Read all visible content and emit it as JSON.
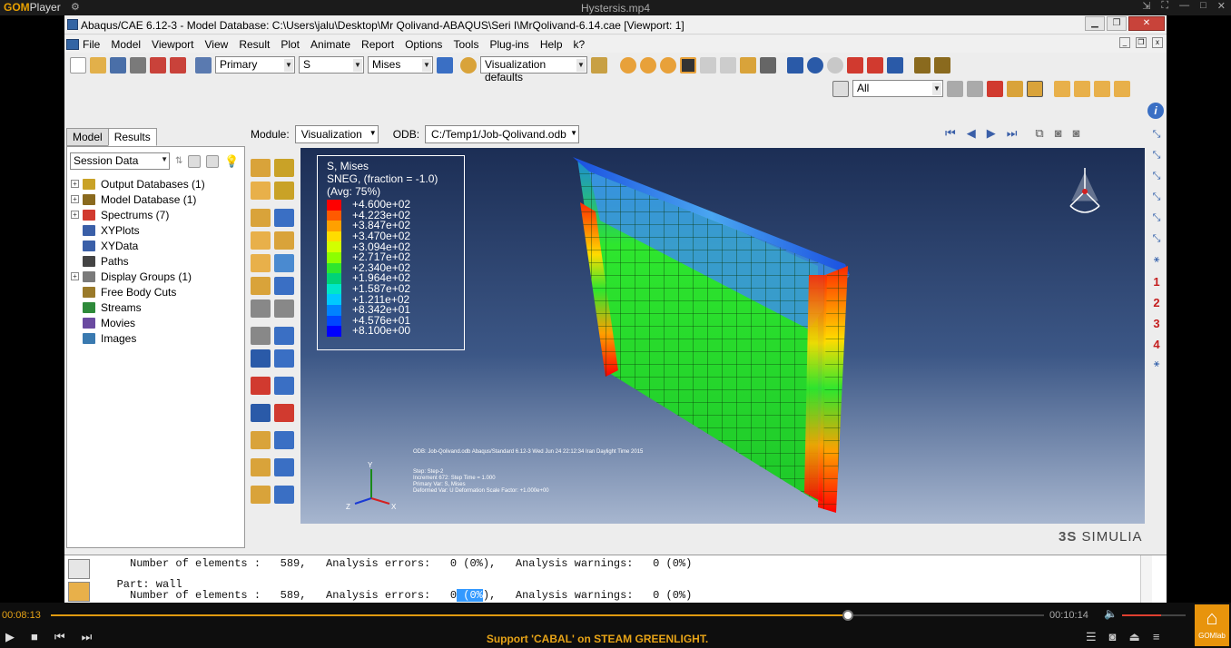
{
  "player": {
    "logo_main": "GOM",
    "logo_sub": "Player",
    "filename": "Hystersis.mp4",
    "time_current": "00:08:13",
    "time_total": "00:10:14",
    "progress": 0.803,
    "volume": 0.62,
    "banner": "Support 'CABAL' on STEAM GREENLIGHT.",
    "brand_label": "GOMlab"
  },
  "app": {
    "title": "Abaqus/CAE 6.12-3 - Model Database: C:\\Users\\jalu\\Desktop\\Mr Qolivand-ABAQUS\\Seri I\\MrQolivand-6.14.cae [Viewport: 1]",
    "menu": [
      "File",
      "Model",
      "Viewport",
      "View",
      "Result",
      "Plot",
      "Animate",
      "Report",
      "Options",
      "Tools",
      "Plug-ins",
      "Help",
      "k?"
    ],
    "toolbar": {
      "field_primary": "Primary",
      "field_var": "S",
      "field_invariant": "Mises",
      "viz_defaults": "Visualization defaults",
      "selection_filter": "All"
    },
    "tabs": [
      "Model",
      "Results"
    ],
    "session_select": "Session Data",
    "tree": [
      {
        "label": "Output Databases (1)",
        "expand": true,
        "color": "#c9a227"
      },
      {
        "label": "Model Database (1)",
        "expand": true,
        "color": "#8a6a1e"
      },
      {
        "label": "Spectrums (7)",
        "expand": true,
        "color": "#d13a2f"
      },
      {
        "label": "XYPlots",
        "expand": false,
        "color": "#3a5fa8"
      },
      {
        "label": "XYData",
        "expand": false,
        "color": "#3a5fa8"
      },
      {
        "label": "Paths",
        "expand": false,
        "color": "#444444"
      },
      {
        "label": "Display Groups (1)",
        "expand": true,
        "color": "#7a7a7a"
      },
      {
        "label": "Free Body Cuts",
        "expand": false,
        "color": "#9a7a2a"
      },
      {
        "label": "Streams",
        "expand": false,
        "color": "#2e8a3a"
      },
      {
        "label": "Movies",
        "expand": false,
        "color": "#6a4aa0"
      },
      {
        "label": "Images",
        "expand": false,
        "color": "#3a7ab0"
      }
    ],
    "module_label": "Module:",
    "module_value": "Visualization",
    "odb_label": "ODB:",
    "odb_value": "C:/Temp1/Job-Qolivand.odb",
    "legend": {
      "line1": "S, Mises",
      "line2": "SNEG, (fraction = -1.0)",
      "line3": "(Avg: 75%)",
      "values": [
        "+4.600e+02",
        "+4.223e+02",
        "+3.847e+02",
        "+3.470e+02",
        "+3.094e+02",
        "+2.717e+02",
        "+2.340e+02",
        "+1.964e+02",
        "+1.587e+02",
        "+1.211e+02",
        "+8.342e+01",
        "+4.576e+01",
        "+8.100e+00"
      ],
      "colors": [
        "#ff0000",
        "#ff5a00",
        "#ffa000",
        "#ffdc00",
        "#d2ff00",
        "#8cff00",
        "#2ee62e",
        "#00d278",
        "#00e6c8",
        "#00c8ff",
        "#0082ff",
        "#0046ff",
        "#0000ff"
      ]
    },
    "vp_info": {
      "line1": "ODB: Job-Qolivand.odb    Abaqus/Standard 6.12-3    Wed Jun 24 22:12:34 Iran Daylight Time 2015",
      "line2": "Step: Step-2",
      "line3": "Increment    672: Step Time =    1.000",
      "line4": "Primary Var: S, Mises",
      "line5": "Deformed Var: U   Deformation Scale Factor: +1.000e+00"
    },
    "triad": {
      "y": "Y",
      "z": "Z",
      "x": "X"
    },
    "right_numbers": [
      "1",
      "2",
      "3",
      "4"
    ],
    "simulia_mark": "3S",
    "simulia_text": "SIMULIA",
    "console": {
      "line1": "     Number of elements :   589,   Analysis errors:   0 (0%),   Analysis warnings:   0 (0%)",
      "line2": "",
      "line3": "   Part: wall",
      "line4a": "     Number of elements :   589,   Analysis errors:   0",
      "line4b": " (0%",
      "line4c": "),   Analysis warnings:   0 (0%)"
    }
  }
}
